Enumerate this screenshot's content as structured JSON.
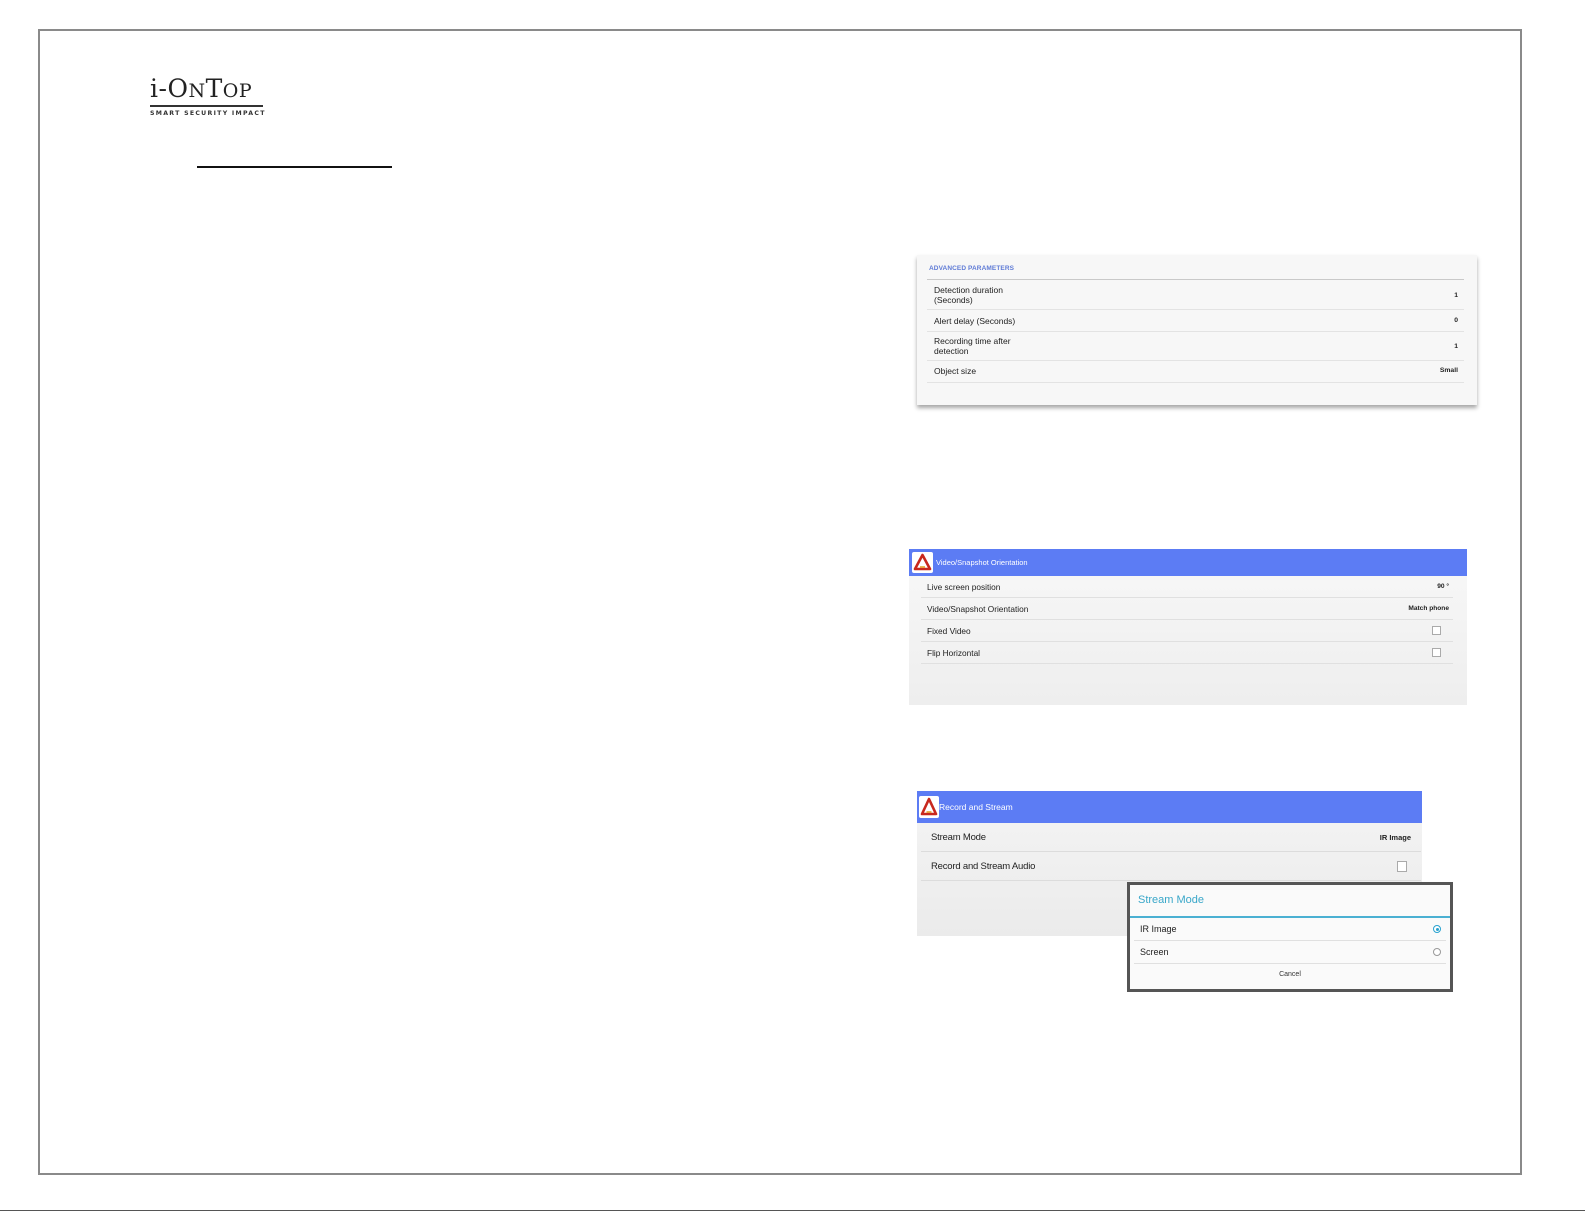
{
  "logo": {
    "wordmark_parts": [
      "i-O",
      "N",
      "T",
      "OP"
    ],
    "tagline": "SMART SECURITY IMPACT"
  },
  "advanced_parameters": {
    "header": "ADVANCED PARAMETERS",
    "rows": [
      {
        "label": "Detection duration\n(Seconds)",
        "value": "1"
      },
      {
        "label": "Alert delay (Seconds)",
        "value": "0"
      },
      {
        "label": "Recording time after\ndetection",
        "value": "1"
      },
      {
        "label": "Object size",
        "value": "Small"
      }
    ]
  },
  "orientation": {
    "title": "Video/Snapshot Orientation",
    "rows": [
      {
        "label": "Live screen position",
        "value": "90 °"
      },
      {
        "label": "Video/Snapshot Orientation",
        "value": "Match phone"
      },
      {
        "label": "Fixed Video",
        "checked": false
      },
      {
        "label": "Flip Horizontal",
        "checked": false
      }
    ]
  },
  "record_stream": {
    "title": "Record and Stream",
    "rows": [
      {
        "label": "Stream Mode",
        "value": "IR Image"
      },
      {
        "label": "Record and Stream Audio",
        "checked": false
      }
    ]
  },
  "stream_mode_dialog": {
    "title": "Stream Mode",
    "options": [
      {
        "label": "IR Image",
        "selected": true
      },
      {
        "label": "Screen",
        "selected": false
      }
    ],
    "cancel_label": "Cancel"
  },
  "colors": {
    "app_bar": "#5c7cf4",
    "header_blue": "#5f7bd6",
    "dialog_accent": "#39a7c9"
  }
}
